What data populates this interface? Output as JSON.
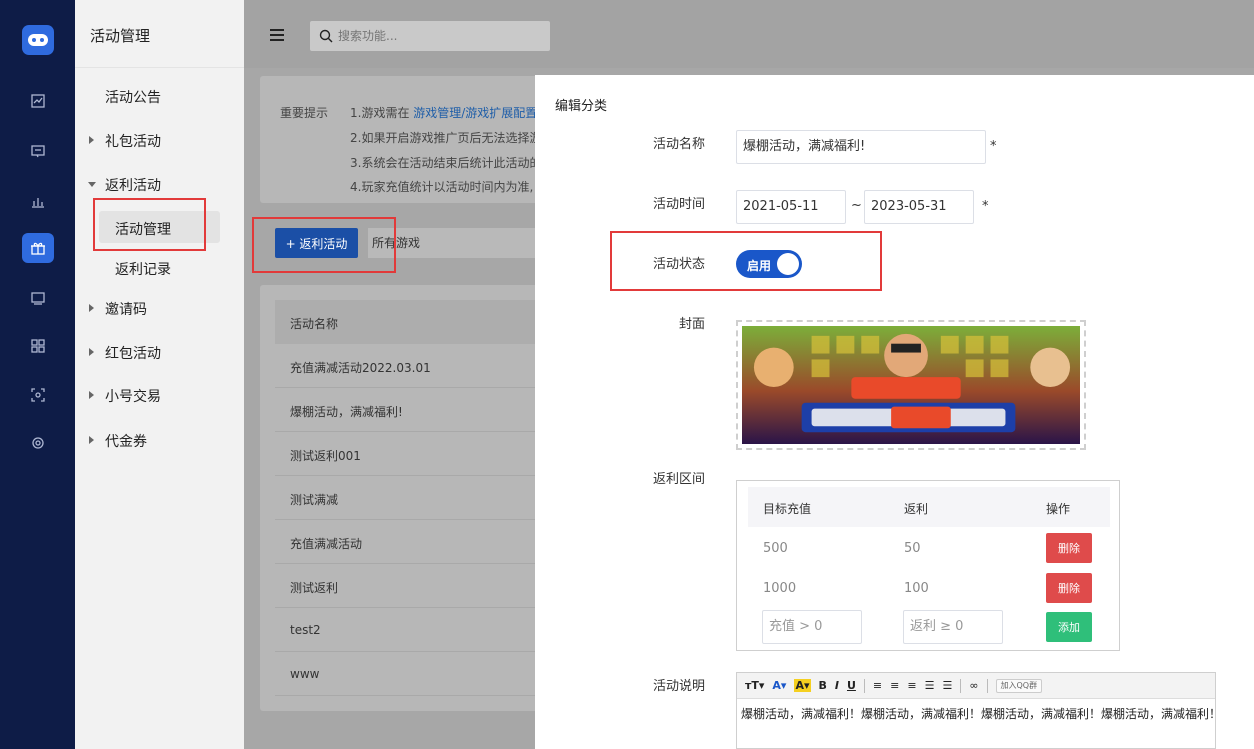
{
  "rail": {
    "icons": [
      "gamepad-logo-icon",
      "line-chart-icon",
      "message-icon",
      "bar-chart-icon",
      "gift-icon",
      "ad-icon",
      "apps-grid-icon",
      "scan-icon",
      "settings-icon"
    ],
    "accent": "#2f6bdf",
    "bg": "#0e1c47"
  },
  "menu": {
    "title": "活动管理",
    "items": {
      "announcement": "活动公告",
      "gift": "礼包活动",
      "rebate": "返利活动",
      "rebate_manage": "活动管理",
      "rebate_records": "返利记录",
      "invite": "邀请码",
      "redpacket": "红包活动",
      "trade": "小号交易",
      "voucher": "代金券"
    }
  },
  "topbar": {
    "search_placeholder": "搜索功能..."
  },
  "main": {
    "notice_label": "重要提示",
    "notice_line1_prefix": "1.游戏需在 ",
    "notice_line1_link": "游戏管理/游戏扩展配置",
    "notice_line2": "2.如果开启游戏推广页后无法选择游",
    "notice_line3": "3.系统会在活动结束后统计此活动的",
    "notice_line4": "4.玩家充值统计以活动时间内为准,",
    "add_button": "+ 返利活动",
    "game_select": "所有游戏",
    "list_header": "活动名称",
    "rows": [
      "充值满减活动2022.03.01",
      "爆棚活动，满减福利!",
      "测试返利001",
      "测试满减",
      "充值满减活动",
      "测试返利",
      "test2",
      "www"
    ]
  },
  "drawer": {
    "title": "编辑分类",
    "name_label": "活动名称",
    "name_value": "爆棚活动，满减福利!",
    "time_label": "活动时间",
    "start_date": "2021-05-11",
    "end_date": "2023-05-31",
    "tilde": "~",
    "required": "*",
    "status_label": "活动状态",
    "status_value": "启用",
    "cover_label": "封面",
    "range_label": "返利区间",
    "table_headers": [
      "目标充值",
      "返利",
      "操作"
    ],
    "ranges": [
      {
        "target": "500",
        "rebate": "50",
        "action": "删除"
      },
      {
        "target": "1000",
        "rebate": "100",
        "action": "删除"
      }
    ],
    "target_placeholder": "充值 > 0",
    "rebate_placeholder": "返利 ≥ 0",
    "add_label": "添加",
    "desc_label": "活动说明",
    "toolbar": {
      "font_size": "тT▾",
      "font_color": "A▾",
      "bg_color": "A▾",
      "bold": "B",
      "italic": "I",
      "underline": "U",
      "qq": "加入QQ群"
    },
    "desc_content": "爆棚活动，满减福利！爆棚活动，满减福利！爆棚活动，满减福利！爆棚活动，满减福利！"
  }
}
